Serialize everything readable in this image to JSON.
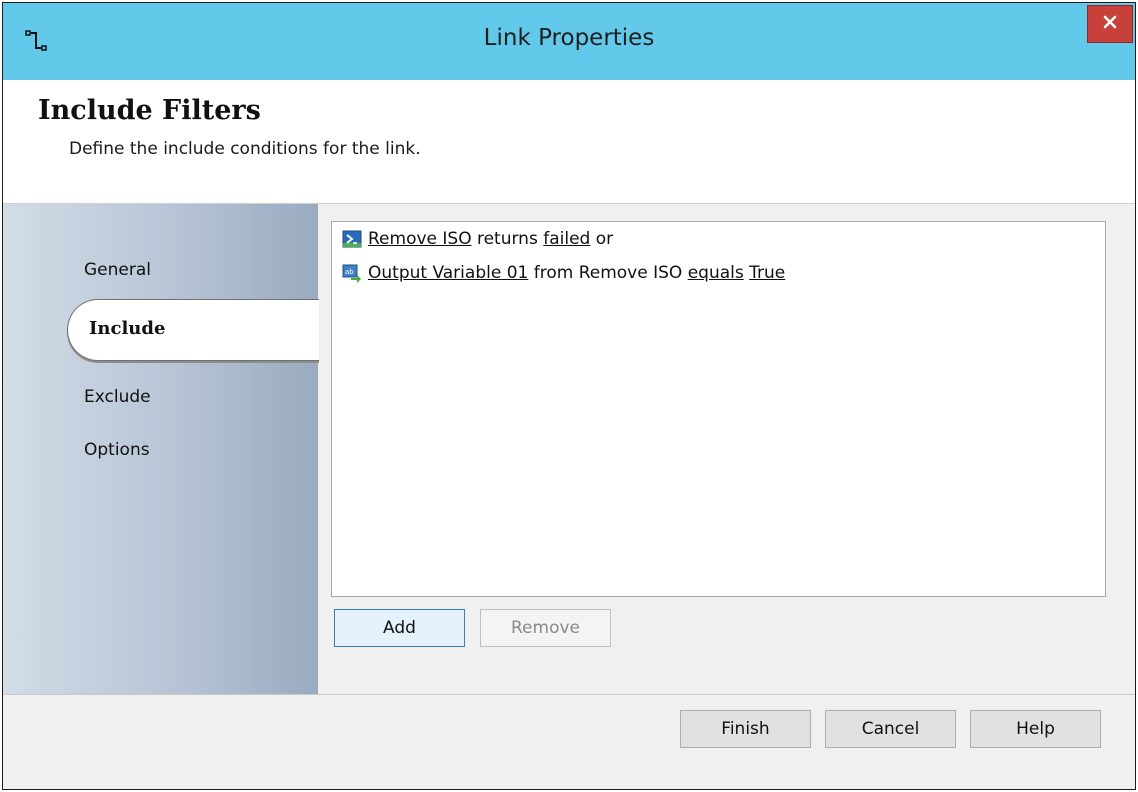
{
  "window": {
    "title": "Link Properties",
    "close_label": "x"
  },
  "header": {
    "title": "Include Filters",
    "description": "Define the include conditions for the link."
  },
  "sidebar": {
    "items": [
      {
        "label": "General"
      },
      {
        "label": "Include"
      },
      {
        "label": "Exclude"
      },
      {
        "label": "Options"
      }
    ],
    "selected": "Include"
  },
  "conditions": [
    {
      "icon": "powershell-activity-icon",
      "parts": [
        {
          "text": "Remove ISO",
          "link": true
        },
        {
          "text": " returns ",
          "link": false
        },
        {
          "text": "failed",
          "link": true
        },
        {
          "text": " or",
          "link": false
        }
      ]
    },
    {
      "icon": "variable-data-icon",
      "parts": [
        {
          "text": "Output Variable 01",
          "link": true
        },
        {
          "text": " from Remove ISO ",
          "link": false
        },
        {
          "text": "equals",
          "link": true
        },
        {
          "text": " ",
          "link": false
        },
        {
          "text": "True",
          "link": true
        }
      ]
    }
  ],
  "buttons": {
    "add": "Add",
    "remove": "Remove",
    "finish": "Finish",
    "cancel": "Cancel",
    "help": "Help"
  },
  "colors": {
    "titlebar": "#62c9ea",
    "close": "#c7413a",
    "sidebar_start": "#d3dce7",
    "sidebar_end": "#9aabc0"
  }
}
